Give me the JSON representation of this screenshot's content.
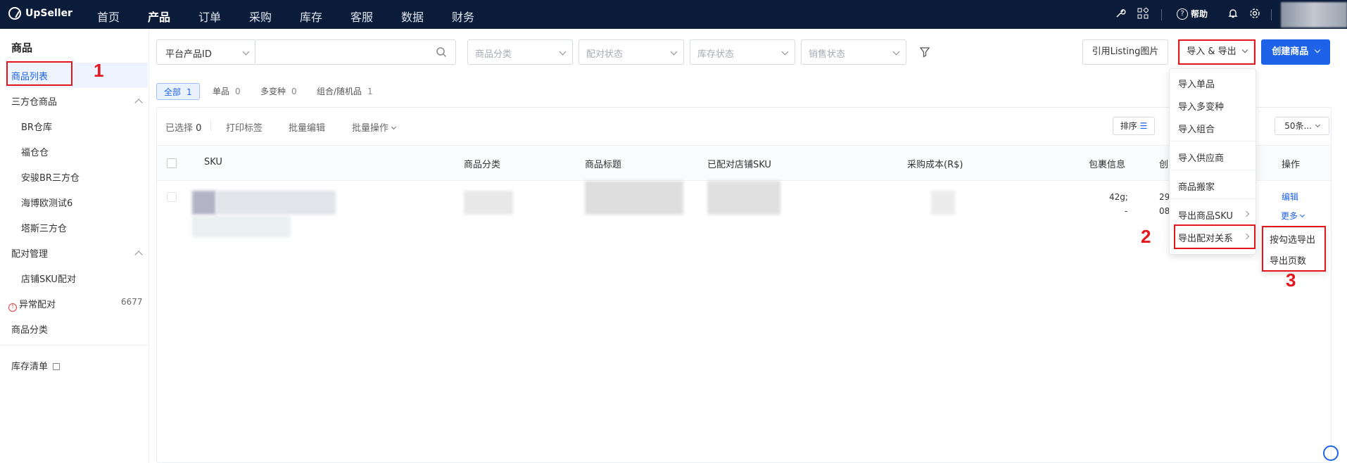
{
  "app": {
    "name": "UpSeller"
  },
  "nav": {
    "items": [
      {
        "label": "首页",
        "active": false
      },
      {
        "label": "产品",
        "active": true
      },
      {
        "label": "订单",
        "active": false
      },
      {
        "label": "采购",
        "active": false
      },
      {
        "label": "库存",
        "active": false
      },
      {
        "label": "客服",
        "active": false
      },
      {
        "label": "数据",
        "active": false
      },
      {
        "label": "财务",
        "active": false
      }
    ],
    "help_label": "帮助"
  },
  "sidebar": {
    "title": "商品",
    "product_list": "商品列表",
    "third_party_wh": "三方仓商品",
    "wh_items": [
      "BR仓库",
      "福仓仓",
      "安骏BR三方仓",
      "海博欧测试6",
      "塔斯三方仓"
    ],
    "pairing": "配对管理",
    "store_sku_pairing": "店铺SKU配对",
    "abnormal_pairing": "异常配对",
    "abnormal_count": "6677",
    "category": "商品分类",
    "inventory_list": "库存清单"
  },
  "filters": {
    "id_type": "平台产品ID",
    "category_placeholder": "商品分类",
    "pair_status_placeholder": "配对状态",
    "stock_status_placeholder": "库存状态",
    "sale_status_placeholder": "销售状态"
  },
  "actions": {
    "listing_image": "引用Listing图片",
    "import_export": "导入 & 导出",
    "create_product": "创建商品"
  },
  "tabs": [
    {
      "label": "全部",
      "count": "1",
      "active": true
    },
    {
      "label": "单品",
      "count": "0",
      "active": false
    },
    {
      "label": "多变种",
      "count": "0",
      "active": false
    },
    {
      "label": "组合/随机品",
      "count": "1",
      "active": false
    }
  ],
  "toolbar": {
    "selected_label": "已选择",
    "selected_count": "0",
    "print_label": "打印标签",
    "batch_edit": "批量编辑",
    "batch_ops": "批量操作",
    "sort": "排序",
    "page_size": "50条..."
  },
  "table": {
    "headers": [
      "SKU",
      "商品分类",
      "商品标题",
      "已配对店铺SKU",
      "采购成本(R$)",
      "包裹信息",
      "创",
      "操作"
    ],
    "row": {
      "package_line1": "42g;",
      "package_line2": "-",
      "created_line1": "29",
      "created_line2": "08",
      "edit": "编辑",
      "more": "更多"
    }
  },
  "import_export_menu": {
    "items": [
      "导入单品",
      "导入多变种",
      "导入组合",
      "导入供应商",
      "商品搬家",
      "导出商品SKU",
      "导出配对关系"
    ]
  },
  "export_submenu": {
    "items": [
      "按勾选导出",
      "导出页数"
    ]
  },
  "annotations": [
    "1",
    "2",
    "3"
  ],
  "colors": {
    "topbar": "#0b1c3a",
    "accent": "#1e62e8",
    "annotation": "#e3171b"
  },
  "icons": [
    "search-icon",
    "filter-icon",
    "help-icon",
    "bell-icon",
    "gear-icon",
    "wrench-icon",
    "apps-icon",
    "warning-icon",
    "external-link-icon",
    "sort-icon",
    "support-icon"
  ]
}
